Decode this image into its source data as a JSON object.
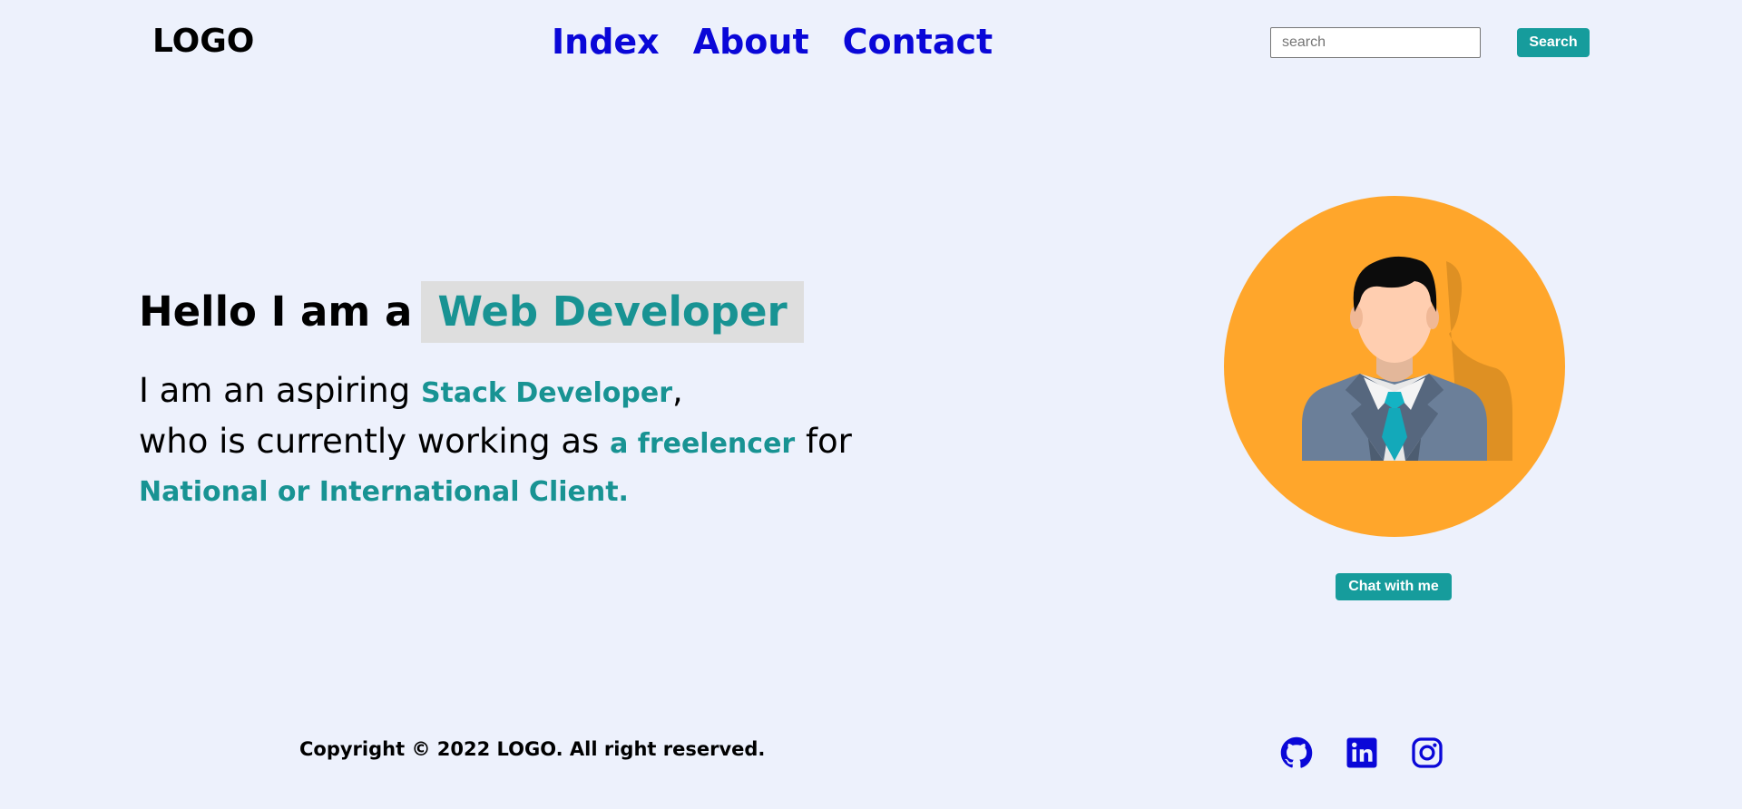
{
  "header": {
    "logo": "LOGO",
    "nav": [
      "Index",
      "About",
      "Contact"
    ],
    "search": {
      "placeholder": "search",
      "button_label": "Search"
    }
  },
  "hero": {
    "title_prefix": "Hello I am a",
    "title_highlight": "Web Developer",
    "line1": {
      "text": "I am an aspiring",
      "accent": "Stack Developer",
      "suffix": ","
    },
    "line2": {
      "text": "who is currently working as",
      "accent": "a freelencer",
      "suffix": "for"
    },
    "line3": "National or International Client."
  },
  "avatar": {
    "icon": "person-avatar-icon",
    "chat_button": "Chat with me"
  },
  "footer": {
    "copyright": "Copyright © 2022 LOGO. All right reserved.",
    "social": [
      "github-icon",
      "linkedin-icon",
      "instagram-icon"
    ]
  },
  "colors": {
    "background": "#edf1fc",
    "nav_link": "#0a07d8",
    "accent": "#189393",
    "button": "#169c9c",
    "avatar_circle": "#ffa62b",
    "highlight_bg": "#dedede"
  }
}
